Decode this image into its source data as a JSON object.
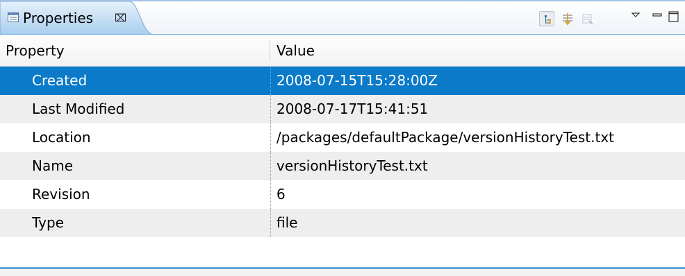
{
  "tab": {
    "title": "Properties",
    "close_glyph": "⌧",
    "icon": "properties-icon"
  },
  "toolbar": {
    "buttons": [
      {
        "icon": "show-categories-icon",
        "active": true
      },
      {
        "icon": "show-advanced-properties-icon",
        "active": false
      },
      {
        "icon": "restore-default-value-icon",
        "active": false
      },
      {
        "icon": "view-menu-icon",
        "active": false
      },
      {
        "icon": "minimize-icon",
        "active": false
      },
      {
        "icon": "maximize-icon",
        "active": false
      }
    ]
  },
  "columns": [
    "Property",
    "Value"
  ],
  "rows": [
    {
      "property": "Created",
      "value": "2008-07-15T15:28:00Z",
      "selected": true
    },
    {
      "property": "Last Modified",
      "value": "2008-07-17T15:41:51",
      "selected": false
    },
    {
      "property": "Location",
      "value": "/packages/defaultPackage/versionHistoryTest.txt",
      "selected": false
    },
    {
      "property": "Name",
      "value": "versionHistoryTest.txt",
      "selected": false
    },
    {
      "property": "Revision",
      "value": "6",
      "selected": false
    },
    {
      "property": "Type",
      "value": "file",
      "selected": false
    }
  ],
  "colors": {
    "selection": "#0a7ac9",
    "accent": "#4d97d7",
    "alt_row": "#eeeeee"
  }
}
